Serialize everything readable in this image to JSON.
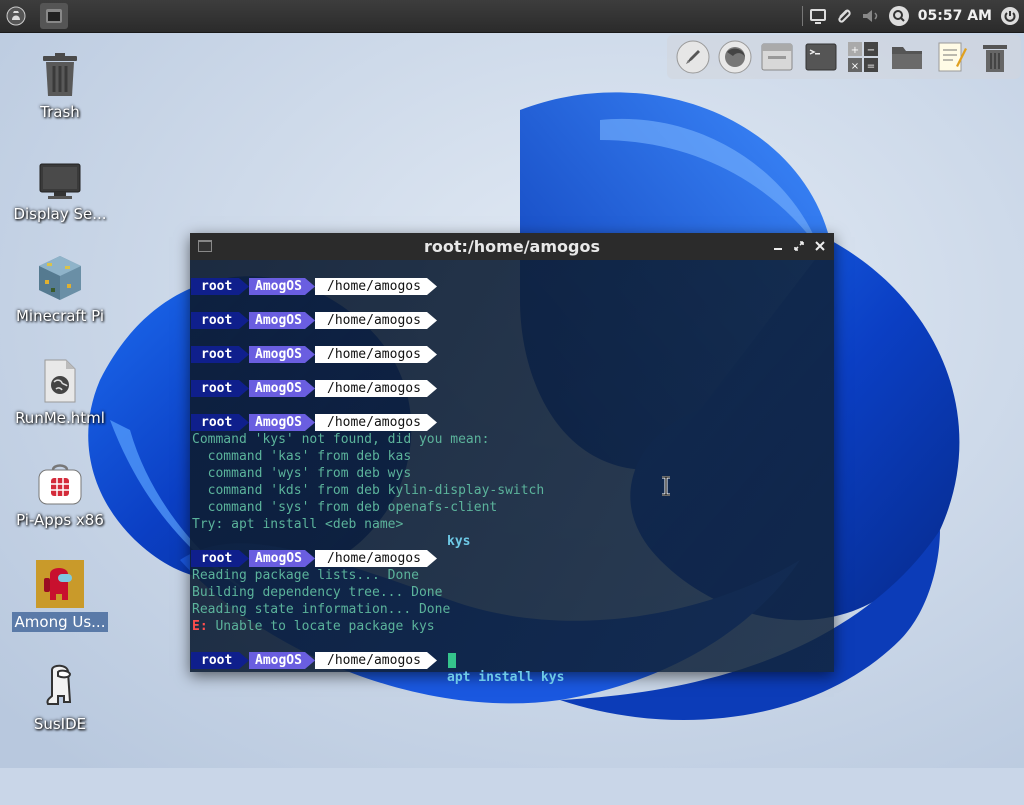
{
  "top_panel": {
    "clock": "05:57 AM"
  },
  "desktop_icons": [
    {
      "label": "Trash",
      "icon": "trash-icon"
    },
    {
      "label": "Display Se...",
      "icon": "monitor-icon"
    },
    {
      "label": "Minecraft Pi",
      "icon": "minecraft-icon"
    },
    {
      "label": "RunMe.html",
      "icon": "html-file-icon"
    },
    {
      "label": "Pi-Apps x86",
      "icon": "pi-apps-icon"
    },
    {
      "label": "Among Us...",
      "icon": "among-us-icon"
    },
    {
      "label": "SusIDE",
      "icon": "suside-icon"
    }
  ],
  "dock": [
    "launcher-icon",
    "firefox-icon",
    "window-icon",
    "terminal-icon",
    "calculator-icon",
    "folder-icon",
    "text-editor-icon",
    "trash-icon"
  ],
  "terminal": {
    "title": "root:/home/amogos",
    "prompt": {
      "user": "root",
      "host": "AmogOS",
      "path": "/home/amogos"
    },
    "cmd1": "kys",
    "out1": [
      "Command 'kys' not found, did you mean:",
      "  command 'kas' from deb kas",
      "  command 'wys' from deb wys",
      "  command 'kds' from deb kylin-display-switch",
      "  command 'sys' from deb openafs-client",
      "Try: apt install <deb name>"
    ],
    "cmd2": "apt install kys",
    "out2": [
      "Reading package lists... Done",
      "Building dependency tree... Done",
      "Reading state information... Done"
    ],
    "err_prefix": "E:",
    "err_text": " Unable to locate package kys"
  },
  "colors": {
    "prompt_user_bg": "#0f1f8c",
    "prompt_host_bg": "#6a5ee0",
    "output": "#5bb39b",
    "command": "#6ec9e6",
    "error": "#ff4d4d",
    "cursor": "#35c48c"
  }
}
